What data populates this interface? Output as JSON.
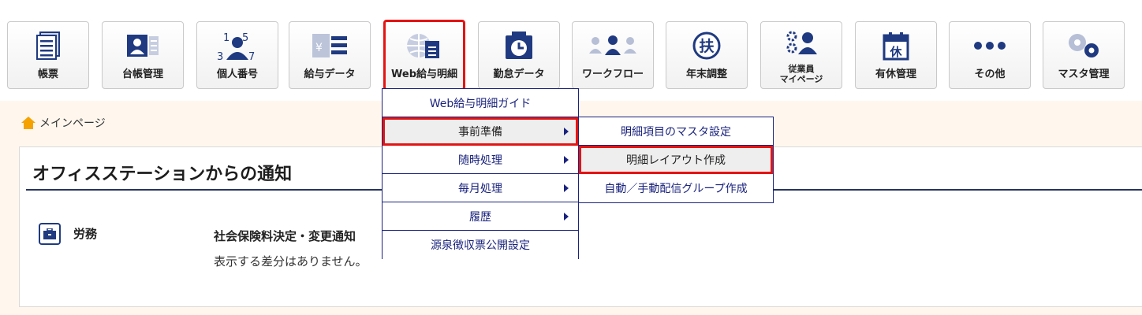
{
  "toolbar": {
    "items": [
      {
        "id": "chohyo",
        "label": "帳票",
        "icon": "document-list-icon"
      },
      {
        "id": "daicho",
        "label": "台帳管理",
        "icon": "id-card-icon"
      },
      {
        "id": "kojin",
        "label": "個人番号",
        "icon": "person-numbers-icon"
      },
      {
        "id": "kyuyo",
        "label": "給与データ",
        "icon": "payroll-data-icon"
      },
      {
        "id": "web",
        "label": "Web給与明細",
        "icon": "globe-document-icon",
        "active": true
      },
      {
        "id": "kintai",
        "label": "勤怠データ",
        "icon": "clock-icon"
      },
      {
        "id": "workflow",
        "label": "ワークフロー",
        "icon": "people-group-icon"
      },
      {
        "id": "nenmatsu",
        "label": "年末調整",
        "icon": "fu-badge-icon",
        "glyph": "扶"
      },
      {
        "id": "mypage",
        "label": "従業員\nマイページ",
        "icon": "employee-gear-icon"
      },
      {
        "id": "yukyu",
        "label": "有休管理",
        "icon": "calendar-icon",
        "glyph": "休"
      },
      {
        "id": "sonota",
        "label": "その他",
        "icon": "more-dots-icon"
      },
      {
        "id": "master",
        "label": "マスタ管理",
        "icon": "gears-icon"
      }
    ]
  },
  "breadcrumb": {
    "label": "メインページ"
  },
  "panel": {
    "title": "オフィスステーションからの通知",
    "category": "労務",
    "notice_title": "社会保険料決定・変更通知",
    "notice_body": "表示する差分はありません。"
  },
  "menu": {
    "items": [
      {
        "label": "Web給与明細ガイド",
        "submenu": false
      },
      {
        "label": "事前準備",
        "submenu": true
      },
      {
        "label": "随時処理",
        "submenu": true
      },
      {
        "label": "毎月処理",
        "submenu": true
      },
      {
        "label": "履歴",
        "submenu": true
      },
      {
        "label": "源泉徴収票公開設定",
        "submenu": false
      }
    ]
  },
  "submenu": {
    "items": [
      {
        "label": "明細項目のマスタ設定"
      },
      {
        "label": "明細レイアウト作成"
      },
      {
        "label": "自動／手動配信グループ作成"
      }
    ]
  },
  "colors": {
    "accent": "#1a237e",
    "highlight": "#e41414",
    "content_bg": "#fff7ee"
  }
}
